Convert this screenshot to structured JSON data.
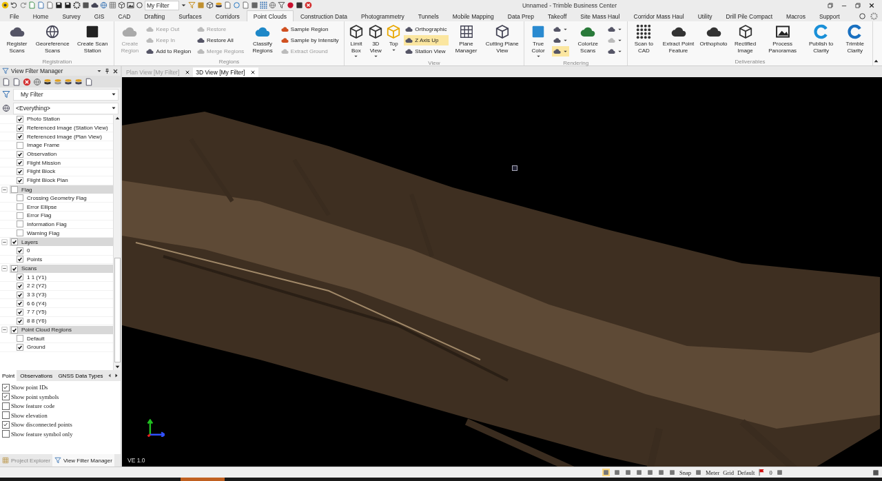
{
  "window": {
    "title": "Unnamed - Trimble Business Center"
  },
  "quick_access": {
    "filter_value": "My Filter"
  },
  "menu_tabs": [
    {
      "label": "File",
      "selected": false
    },
    {
      "label": "Home",
      "selected": false
    },
    {
      "label": "Survey",
      "selected": false
    },
    {
      "label": "GIS",
      "selected": false
    },
    {
      "label": "CAD",
      "selected": false
    },
    {
      "label": "Drafting",
      "selected": false
    },
    {
      "label": "Surfaces",
      "selected": false
    },
    {
      "label": "Corridors",
      "selected": false
    },
    {
      "label": "Point Clouds",
      "selected": true
    },
    {
      "label": "Construction Data",
      "selected": false
    },
    {
      "label": "Photogrammetry",
      "selected": false
    },
    {
      "label": "Tunnels",
      "selected": false
    },
    {
      "label": "Mobile Mapping",
      "selected": false
    },
    {
      "label": "Data Prep",
      "selected": false
    },
    {
      "label": "Takeoff",
      "selected": false
    },
    {
      "label": "Site Mass Haul",
      "selected": false
    },
    {
      "label": "Corridor Mass Haul",
      "selected": false
    },
    {
      "label": "Utility",
      "selected": false
    },
    {
      "label": "Drill Pile Compact",
      "selected": false
    },
    {
      "label": "Macros",
      "selected": false
    },
    {
      "label": "Support",
      "selected": false
    }
  ],
  "ribbon": {
    "groups": [
      {
        "label": "Registration",
        "items": [
          {
            "kind": "large",
            "label": "Register Scans",
            "disabled": false,
            "dropdown": false
          },
          {
            "kind": "large",
            "label": "Georeference Scans",
            "disabled": false,
            "dropdown": false
          },
          {
            "kind": "large",
            "label": "Create Scan Station",
            "disabled": false,
            "dropdown": false
          }
        ]
      },
      {
        "label": "Regions",
        "items": [
          {
            "kind": "large",
            "label": "Create Region",
            "disabled": true,
            "dropdown": false
          },
          {
            "kind": "stack",
            "items": [
              {
                "label": "Keep Out",
                "disabled": true,
                "selected": false
              },
              {
                "label": "Keep In",
                "disabled": true,
                "selected": false
              },
              {
                "label": "Add to Region",
                "disabled": false,
                "selected": false
              }
            ]
          },
          {
            "kind": "stack",
            "items": [
              {
                "label": "Restore",
                "disabled": true,
                "selected": false
              },
              {
                "label": "Restore All",
                "disabled": false,
                "selected": false
              },
              {
                "label": "Merge Regions",
                "disabled": true,
                "selected": false
              }
            ]
          },
          {
            "kind": "large",
            "label": "Classify Regions",
            "disabled": false,
            "dropdown": false
          },
          {
            "kind": "stack",
            "items": [
              {
                "label": "Sample Region",
                "disabled": false,
                "selected": false
              },
              {
                "label": "Sample by Intensity",
                "disabled": false,
                "selected": false
              },
              {
                "label": "Extract Ground",
                "disabled": true,
                "selected": false
              }
            ]
          }
        ]
      },
      {
        "label": "View",
        "items": [
          {
            "kind": "large",
            "label": "Limit Box",
            "disabled": false,
            "dropdown": true
          },
          {
            "kind": "large",
            "label": "3D View",
            "disabled": false,
            "dropdown": true
          },
          {
            "kind": "large",
            "label": "Top",
            "disabled": false,
            "dropdown": true
          },
          {
            "kind": "stack",
            "items": [
              {
                "label": "Orthographic",
                "disabled": false,
                "selected": false
              },
              {
                "label": "Z Axis Up",
                "disabled": false,
                "selected": true
              },
              {
                "label": "Station View",
                "disabled": false,
                "selected": false
              }
            ]
          },
          {
            "kind": "large",
            "label": "Plane Manager",
            "disabled": false,
            "dropdown": false
          },
          {
            "kind": "large",
            "label": "Cutting Plane View",
            "disabled": false,
            "dropdown": false
          }
        ]
      },
      {
        "label": "Rendering",
        "items": [
          {
            "kind": "large",
            "label": "True Color",
            "disabled": false,
            "dropdown": true
          },
          {
            "kind": "stack",
            "items": [
              {
                "disabled": false,
                "selected": false
              },
              {
                "disabled": false,
                "selected": false
              },
              {
                "disabled": false,
                "selected": true
              }
            ]
          },
          {
            "kind": "large",
            "label": "Colorize Scans",
            "disabled": false,
            "dropdown": false
          },
          {
            "kind": "stack",
            "items": [
              {
                "disabled": false,
                "selected": false
              },
              {
                "disabled": true,
                "selected": false
              },
              {
                "disabled": false,
                "selected": false
              }
            ]
          }
        ]
      },
      {
        "label": "Deliverables",
        "items": [
          {
            "kind": "large",
            "label": "Scan to CAD",
            "disabled": false,
            "dropdown": false
          },
          {
            "kind": "large",
            "label": "Extract Point Feature",
            "disabled": false,
            "dropdown": false
          },
          {
            "kind": "large",
            "label": "Orthophoto",
            "disabled": false,
            "dropdown": false
          },
          {
            "kind": "large",
            "label": "Rectified Image",
            "disabled": false,
            "dropdown": false
          },
          {
            "kind": "large",
            "label": "Process Panoramas",
            "disabled": false,
            "dropdown": false
          },
          {
            "kind": "large",
            "label": "Publish to Clarity",
            "disabled": false,
            "dropdown": false
          },
          {
            "kind": "large",
            "label": "Trimble Clarity",
            "disabled": false,
            "dropdown": false
          }
        ]
      }
    ]
  },
  "filter_panel": {
    "title": "View Filter Manager",
    "filter_value": "My Filter",
    "scope_value": "<Everything>",
    "tree": [
      {
        "children": [
          {
            "label": "Photo Station",
            "checked": true
          },
          {
            "label": "Referenced Image (Station View)",
            "checked": true
          },
          {
            "label": "Referenced Image (Plan View)",
            "checked": true
          },
          {
            "label": "Image Frame",
            "checked": false
          },
          {
            "label": "Observation",
            "checked": true
          },
          {
            "label": "Flight Mission",
            "checked": true
          },
          {
            "label": "Flight Block",
            "checked": true
          },
          {
            "label": "Flight Block Plan",
            "checked": true
          }
        ]
      },
      {
        "label": "Flag",
        "checked": false,
        "expanded": true,
        "children": [
          {
            "label": "Crossing Geometry Flag",
            "checked": false
          },
          {
            "label": "Error Ellipse",
            "checked": false
          },
          {
            "label": "Error Flag",
            "checked": false
          },
          {
            "label": "Information Flag",
            "checked": false
          },
          {
            "label": "Warning Flag",
            "checked": false
          }
        ]
      },
      {
        "label": "Layers",
        "checked": true,
        "expanded": true,
        "children": [
          {
            "label": "0",
            "checked": true
          },
          {
            "label": "Points",
            "checked": true
          }
        ]
      },
      {
        "label": "Scans",
        "checked": true,
        "expanded": true,
        "children": [
          {
            "label": "1 1 (Y1)",
            "checked": true
          },
          {
            "label": "2 2 (Y2)",
            "checked": true
          },
          {
            "label": "3 3 (Y3)",
            "checked": true
          },
          {
            "label": "6 6 (Y4)",
            "checked": true
          },
          {
            "label": "7 7 (Y5)",
            "checked": true
          },
          {
            "label": "8 8 (Y6)",
            "checked": true
          }
        ]
      },
      {
        "label": "Point Cloud Regions",
        "checked": true,
        "expanded": true,
        "children": [
          {
            "label": "Default",
            "checked": false
          },
          {
            "label": "Ground",
            "checked": true
          }
        ]
      }
    ],
    "option_tabs": [
      {
        "label": "Point",
        "selected": true
      },
      {
        "label": "Observations",
        "selected": false
      },
      {
        "label": "GNSS Data Types",
        "selected": false
      }
    ],
    "options": [
      {
        "label": "Show point IDs",
        "checked": true
      },
      {
        "label": "Show point symbols",
        "checked": true
      },
      {
        "label": "Show feature code",
        "checked": false
      },
      {
        "label": "Show elevation",
        "checked": false
      },
      {
        "label": "Show disconnected points",
        "checked": true
      },
      {
        "label": "Show feature symbol only",
        "checked": false
      }
    ]
  },
  "panel_tabs": [
    {
      "label": "Project Explorer",
      "selected": false
    },
    {
      "label": "View Filter Manager",
      "selected": true
    }
  ],
  "document_tabs": [
    {
      "label": "Plan View [My Filter]",
      "selected": false
    },
    {
      "label": "3D View [My Filter]",
      "selected": true
    }
  ],
  "viewport": {
    "scale_label": "VE 1.0"
  },
  "status_bar": {
    "items": [
      {
        "kind": "icon",
        "selected": true
      },
      {
        "kind": "icon",
        "selected": false
      },
      {
        "kind": "icon",
        "selected": false
      },
      {
        "kind": "icon",
        "selected": false
      },
      {
        "kind": "icon",
        "selected": false
      },
      {
        "kind": "icon",
        "selected": false
      },
      {
        "kind": "icon",
        "selected": false
      },
      {
        "kind": "text",
        "label": "Snap"
      },
      {
        "kind": "icon",
        "selected": false
      },
      {
        "kind": "text",
        "label": "Meter"
      },
      {
        "kind": "text",
        "label": "Grid"
      },
      {
        "kind": "text",
        "label": "Default"
      },
      {
        "kind": "flag"
      },
      {
        "kind": "text",
        "label": "0"
      },
      {
        "kind": "icon",
        "selected": false
      }
    ]
  }
}
